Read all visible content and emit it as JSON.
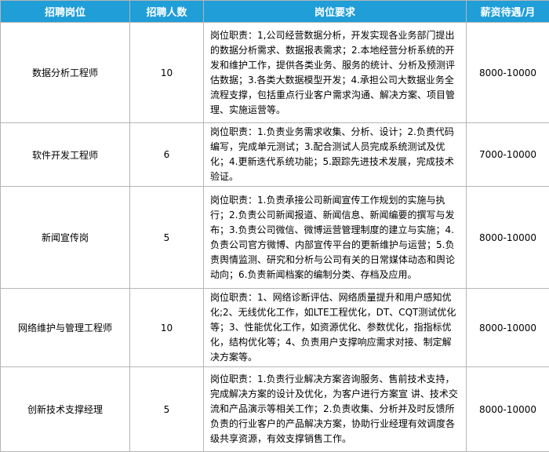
{
  "headers": {
    "title": "招聘岗位",
    "count": "招聘人数",
    "requirement": "岗位要求",
    "salary": "薪资待遇/月"
  },
  "colors": {
    "header_bg": "#1f9ed8",
    "header_text": "#ffffff",
    "border": "#b5b5b5"
  },
  "rows": [
    {
      "title": "数据分析工程师",
      "count": "10",
      "requirement": "岗位职责：1,公司经营数据分析，开发实现各业务部门提出的数据分析需求、数据报表需求；2.本地经营分析系统的开发和维护工作，提供各类业务、服务的统计、分析及预测评估数据；3.各类大数据模型开发；4.承担公司大数据业务全流程支撑，包括重点行业客户需求沟通、解决方案、项目管理、实施运营等。",
      "salary": "8000-10000"
    },
    {
      "title": "软件开发工程师",
      "count": "6",
      "requirement": "岗位职责：1.负责业务需求收集、分析、设计；2.负责代码编写，完成单元测试；3.配合测试人员完成系统测试及优化；4.更新迭代系统功能；5.跟踪先进技术发展，完成技术验证。",
      "salary": "7000-10000"
    },
    {
      "title": "新闻宣传岗",
      "count": "5",
      "requirement": "岗位职责：1.负责承接公司新闻宣传工作规划的实施与执行；2.负责公司新闻报道、新闻信息、新闻编要的撰写与发布；3.负责公司微信、微博运营管理制度的建立与实施；4.负责公司官方微博、内部宣传平台的更新维护与运营；5.负责舆情监测、研究和分析与公司有关的日常媒体动态和舆论动向；6.负责新闻档案的编制分类、存档及应用。",
      "salary": "8000-10000"
    },
    {
      "title": "网络维护与管理工程师",
      "count": "10",
      "requirement": "岗位职责：1、网络诊断评估、网络质量提升和用户感知优化;2、无线优化工作，如LTE工程优化，DT、CQT测试优化等；3、性能优化工作，如资源优化、参数优化，指指标优化，结构优化等；4、负责用户支撑响应需求对接、制定解决方案等。",
      "salary": "8000-10000"
    },
    {
      "title": "创新技术支撑经理",
      "count": "5",
      "requirement": "岗位职责：1.负责行业解决方案咨询服务、售前技术支持，完成解决方案的设计及优化，为客户进行方案宣 讲、技术交流和产品演示等相关工作；2.负责收集、分析并及时反馈所负责的行业客户的产品解决方案，协助行业经理有效调度各级共享资源，有效支撑销售工作。",
      "salary": "8000-10000"
    }
  ]
}
